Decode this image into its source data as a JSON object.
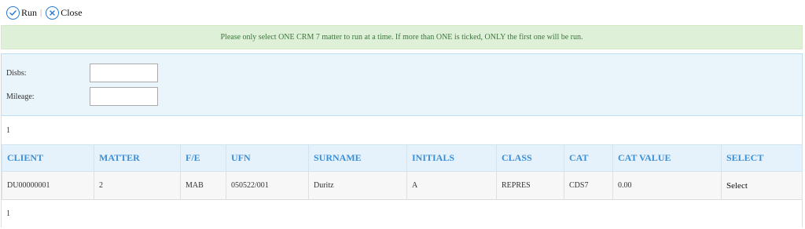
{
  "toolbar": {
    "run_label": "Run",
    "separator": "|",
    "close_label": "Close",
    "run_icon": "check-circle-icon",
    "close_icon": "x-circle-icon",
    "accent_color": "#2a7bd4"
  },
  "notice": {
    "text": "Please only select ONE CRM 7 matter to run at a time. If more than ONE is ticked, ONLY the first one will be run.",
    "color": "#3c763d",
    "background": "#dff0d8"
  },
  "filters": {
    "disbs_label": "Disbs:",
    "disbs_value": "",
    "mileage_label": "Mileage:",
    "mileage_value": ""
  },
  "grid": {
    "page_top": "1",
    "page_bottom": "1",
    "header_color": "#3b8fd6",
    "columns": [
      "CLIENT",
      "MATTER",
      "F/E",
      "UFN",
      "SURNAME",
      "INITIALS",
      "CLASS",
      "CAT",
      "CAT VALUE",
      "SELECT"
    ],
    "rows": [
      {
        "client": "DU00000001",
        "matter": "2",
        "fe": "MAB",
        "ufn": "050522/001",
        "surname": "Duritz",
        "initials": "A",
        "class": "REPRES",
        "cat": "CDS7",
        "cat_value": "0.00",
        "select": "Select"
      }
    ]
  }
}
